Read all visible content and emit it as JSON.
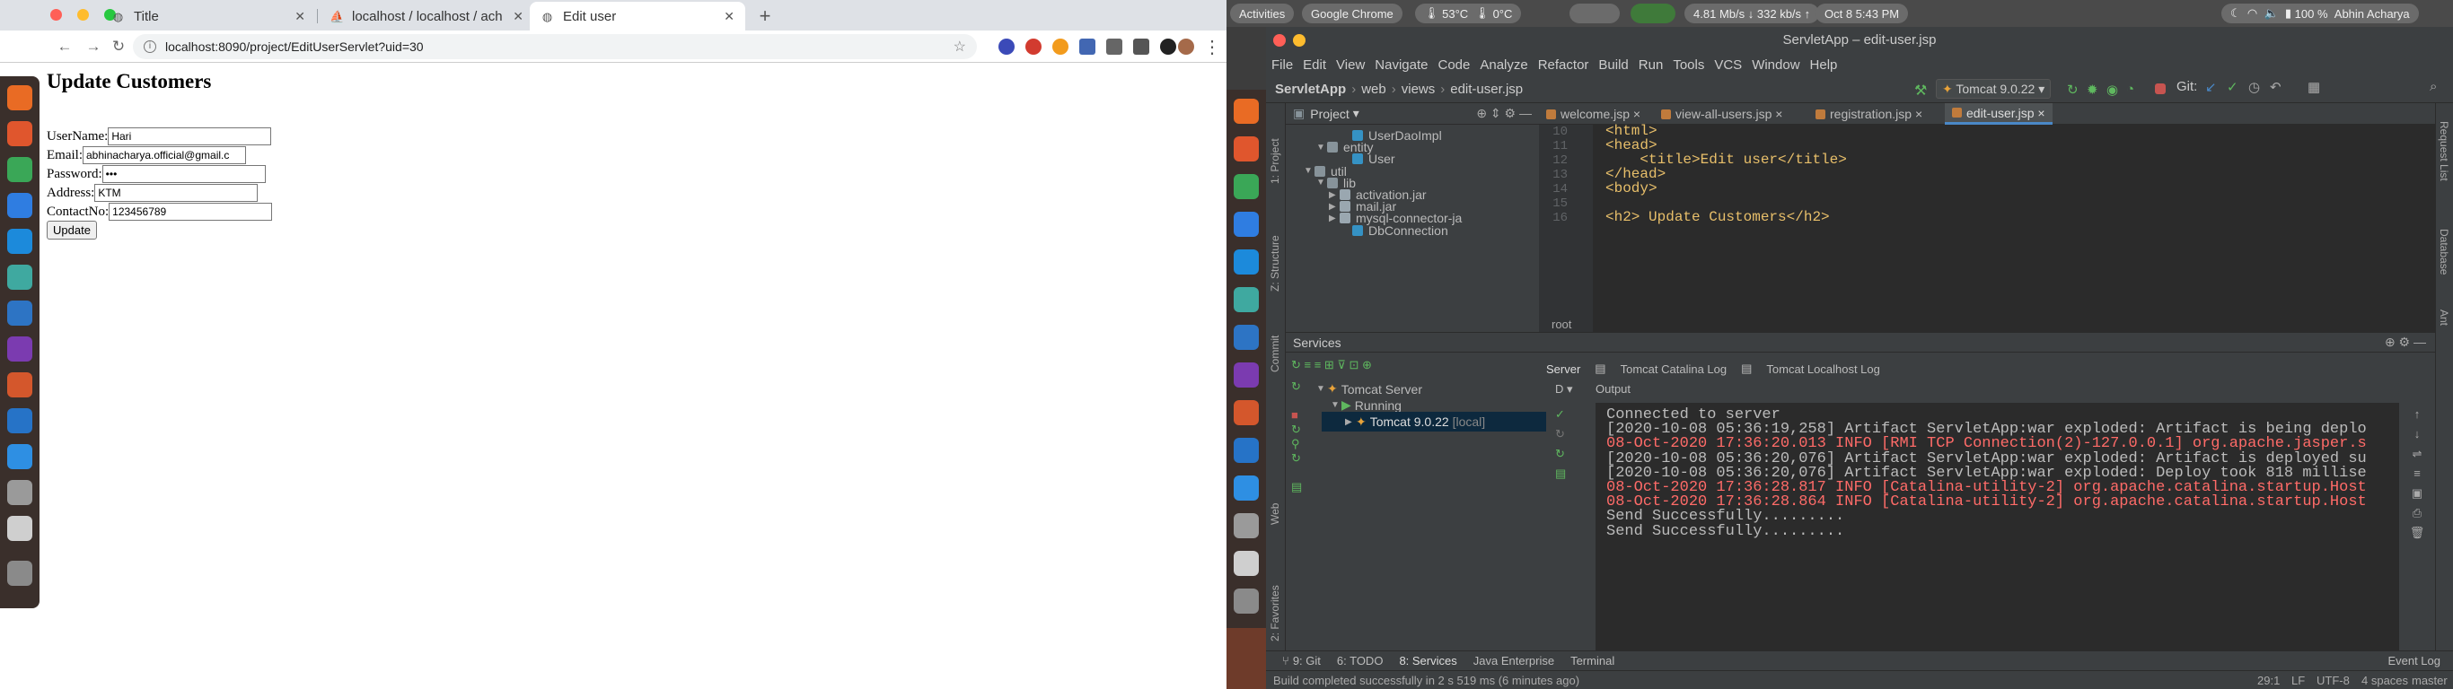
{
  "browser": {
    "tabs": [
      {
        "title": "Title",
        "favicon": "globe-icon"
      },
      {
        "title": "localhost / localhost / ach",
        "favicon": "phpmyadmin-icon"
      },
      {
        "title": "Edit user",
        "favicon": "globe-icon",
        "active": true
      }
    ],
    "url": "localhost:8090/project/EditUserServlet?uid=30",
    "page": {
      "heading": "Update Customers",
      "fields": [
        {
          "label": "UserName:",
          "value": "Hari"
        },
        {
          "label": "Email:",
          "value": "abhinacharya.official@gmail.c"
        },
        {
          "label": "Password:",
          "value": "•••"
        },
        {
          "label": "Address:",
          "value": "KTM"
        },
        {
          "label": "ContactNo:",
          "value": "123456789"
        }
      ],
      "submit_label": "Update"
    }
  },
  "topbar": {
    "activities": "Activities",
    "app": "Google Chrome",
    "temp1": "53°C",
    "temp2": "0°C",
    "datetime": "Oct 8  5:43 PM",
    "down": "4.81",
    "down_unit": "Mb/s",
    "up": "332",
    "up_unit": "kb/s",
    "battery": "100 %",
    "user": "Abhin Acharya"
  },
  "ide": {
    "title": "ServletApp – edit-user.jsp",
    "menu": [
      "File",
      "Edit",
      "View",
      "Navigate",
      "Code",
      "Analyze",
      "Refactor",
      "Build",
      "Run",
      "Tools",
      "VCS",
      "Window",
      "Help"
    ],
    "breadcrumb": [
      "ServletApp",
      "web",
      "views",
      "edit-user.jsp"
    ],
    "run_config": "Tomcat 9.0.22",
    "git_label": "Git:",
    "project_label": "Project",
    "project_tree": [
      {
        "label": "UserDaoImpl",
        "indent": 4
      },
      {
        "label": "entity",
        "indent": 2
      },
      {
        "label": "User",
        "indent": 4
      },
      {
        "label": "util",
        "indent": 1
      },
      {
        "label": "lib",
        "indent": 2
      },
      {
        "label": "activation.jar",
        "indent": 3
      },
      {
        "label": "mail.jar",
        "indent": 3
      },
      {
        "label": "mysql-connector-ja",
        "indent": 3
      },
      {
        "label": "DbConnection",
        "indent": 4
      }
    ],
    "editor_tabs": [
      "welcome.jsp",
      "view-all-users.jsp",
      "registration.jsp",
      "edit-user.jsp"
    ],
    "code_lines": [
      {
        "n": "10",
        "text": "<html>"
      },
      {
        "n": "11",
        "text": "<head>"
      },
      {
        "n": "12",
        "text": "    <title>Edit user</title>"
      },
      {
        "n": "13",
        "text": "</head>"
      },
      {
        "n": "14",
        "text": "<body>"
      },
      {
        "n": "15",
        "text": ""
      },
      {
        "n": "16",
        "text": "<h2> Update Customers</h2>"
      }
    ],
    "root_label": "root",
    "left_strip": [
      "1: Project",
      "Z: Structure",
      "Commit",
      "Web",
      "2: Favorites"
    ],
    "right_strip": [
      "Request List",
      "Database",
      "Ant"
    ],
    "services": {
      "title": "Services",
      "tree": [
        {
          "label": "Tomcat Server"
        },
        {
          "label": "Running"
        },
        {
          "label": "Tomcat 9.0.22",
          "suffix": "[local]"
        }
      ],
      "tabs": [
        "Server",
        "Tomcat Catalina Log",
        "Tomcat Localhost Log"
      ],
      "output_label": "Output",
      "console": [
        {
          "text": "Connected to server",
          "color": "normal"
        },
        {
          "text": "[2020-10-08 05:36:19,258] Artifact ServletApp:war exploded: Artifact is being deplo",
          "color": "normal"
        },
        {
          "text": "08-Oct-2020 17:36:20.013 INFO [RMI TCP Connection(2)-127.0.0.1] org.apache.jasper.s",
          "color": "red"
        },
        {
          "text": "[2020-10-08 05:36:20,076] Artifact ServletApp:war exploded: Artifact is deployed su",
          "color": "normal"
        },
        {
          "text": "[2020-10-08 05:36:20,076] Artifact ServletApp:war exploded: Deploy took 818 millise",
          "color": "normal"
        },
        {
          "text": "08-Oct-2020 17:36:28.817 INFO [Catalina-utility-2] org.apache.catalina.startup.Host",
          "color": "red"
        },
        {
          "text": "08-Oct-2020 17:36:28.864 INFO [Catalina-utility-2] org.apache.catalina.startup.Host",
          "color": "red"
        },
        {
          "text": "Send Successfully.........",
          "color": "normal"
        },
        {
          "text": "Send Successfully.........",
          "color": "normal"
        }
      ]
    },
    "bottom_tabs": [
      "9: Git",
      "6: TODO",
      "8: Services",
      "Java Enterprise",
      "Terminal"
    ],
    "event_log": "Event Log",
    "status": {
      "message": "Build completed successfully in 2 s 519 ms (6 minutes ago)",
      "position": "29:1",
      "line_sep": "LF",
      "encoding": "UTF-8",
      "indent": "4 spaces",
      "branch": "master"
    }
  },
  "colors": {
    "console_red": "#ff6b68",
    "ide_bg": "#2b2b2b",
    "ide_panel": "#3c3f41",
    "accent_blue": "#4a88c7"
  }
}
